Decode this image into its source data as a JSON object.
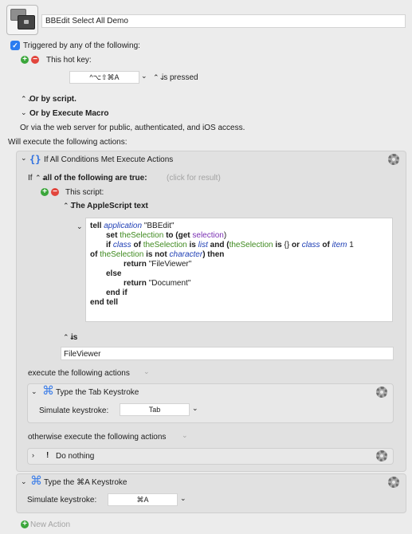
{
  "macro": {
    "name": "BBEdit Select All Demo"
  },
  "trigger": {
    "header": "Triggered by any of the following:",
    "hotkey_label": "This hot key:",
    "hotkey_value": "^⌥⇧⌘A",
    "hotkey_state": "is pressed",
    "or_script": "Or by script.",
    "or_execute_macro": "Or by Execute Macro",
    "web_server_text": "Or via the web server for public, authenticated, and iOS access."
  },
  "actions_header": "Will execute the following actions:",
  "if_action": {
    "title": "If All Conditions Met Execute Actions",
    "if_label": "If",
    "condition_mode": "all of the following are true:",
    "click_hint": "(click for result)",
    "condition_label": "This script:",
    "script_type": "The AppleScript text",
    "script_lines": {
      "l1_tell": "tell",
      "l1_app": "application",
      "l1_str": "\"BBEdit\"",
      "l2_set": "set",
      "l2_var": "theSelection",
      "l2_to": "to (",
      "l2_get": "get",
      "l2_sel": "selection",
      "l2_close": ")",
      "l3_if": "if",
      "l3_class": "class",
      "l3_of": "of",
      "l3_var": "theSelection",
      "l3_is": "is",
      "l3_list": "list",
      "l3_and": "and (",
      "l3_var2": "theSelection",
      "l3_is2": "is",
      "l3_braces": "{}",
      "l3_or": "or",
      "l3_class2": "class",
      "l3_of2": "of",
      "l3_item": "item",
      "l3_num": "1",
      "l4_of": "of",
      "l4_var": "theSelection",
      "l4_isnot": "is not",
      "l4_char": "character",
      "l4_then": ") then",
      "l5_return": "return",
      "l5_str": "\"FileViewer\"",
      "l6_else": "else",
      "l7_return": "return",
      "l7_str": "\"Document\"",
      "l8_endif": "end if",
      "l9_endtell": "end tell"
    },
    "result_operator": "is",
    "result_value": "FileViewer",
    "then_label": "execute the following actions",
    "otherwise_label": "otherwise execute the following actions"
  },
  "tab_action": {
    "title": "Type the Tab Keystroke",
    "simulate_label": "Simulate keystroke:",
    "keystroke": "Tab"
  },
  "nothing_action": {
    "title": "Do nothing"
  },
  "cmda_action": {
    "title": "Type the ⌘A Keystroke",
    "simulate_label": "Simulate keystroke:",
    "keystroke": "⌘A"
  },
  "new_action": "New Action",
  "icons": {
    "macro": "macro-icon",
    "gear": "gear-icon",
    "braces": "if-then-icon",
    "command": "command-key-icon",
    "exclamation": "exclamation-icon"
  },
  "colors": {
    "accent": "#2b7cf0",
    "plus": "#3aa63a",
    "minus": "#e2453c"
  }
}
